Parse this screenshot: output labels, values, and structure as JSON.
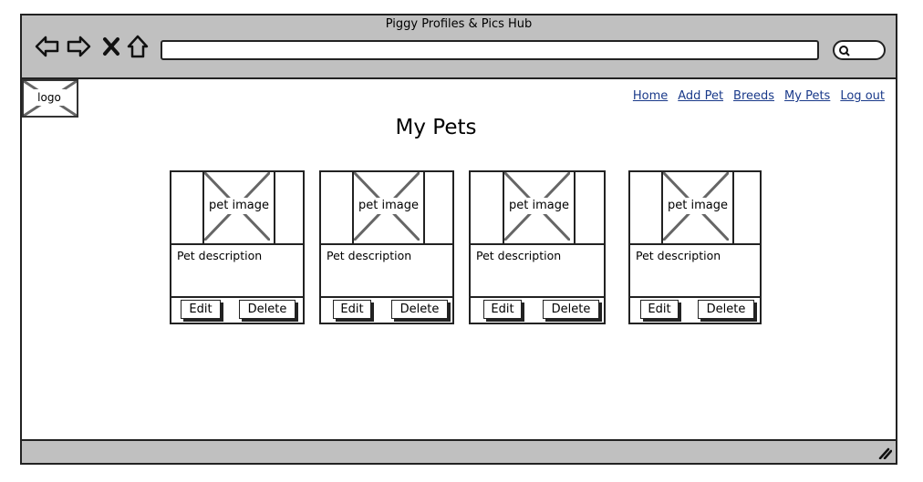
{
  "window": {
    "title": "Piggy Profiles & Pics Hub"
  },
  "logo": {
    "label": "logo"
  },
  "nav": {
    "items": [
      "Home",
      "Add Pet",
      "Breeds",
      "My Pets",
      "Log out"
    ]
  },
  "page": {
    "title": "My Pets"
  },
  "cards": [
    {
      "image_label": "pet image",
      "description": "Pet description",
      "edit_label": "Edit",
      "delete_label": "Delete"
    },
    {
      "image_label": "pet image",
      "description": "Pet description",
      "edit_label": "Edit",
      "delete_label": "Delete"
    },
    {
      "image_label": "pet image",
      "description": "Pet description",
      "edit_label": "Edit",
      "delete_label": "Delete"
    },
    {
      "image_label": "pet image",
      "description": "Pet description",
      "edit_label": "Edit",
      "delete_label": "Delete"
    }
  ],
  "icons": {
    "back": "back-arrow-icon",
    "forward": "forward-arrow-icon",
    "stop": "close-icon",
    "home": "home-icon",
    "search": "search-icon",
    "resize": "resize-grip-icon"
  }
}
